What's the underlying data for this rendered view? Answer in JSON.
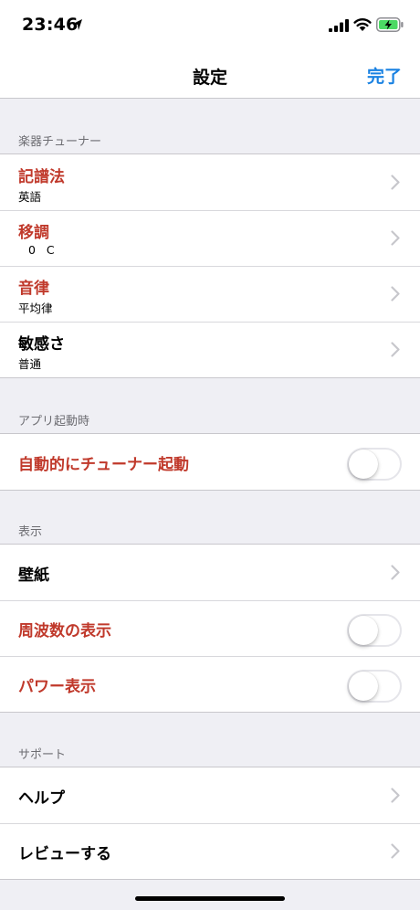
{
  "status_bar": {
    "time": "23:46"
  },
  "nav": {
    "title": "設定",
    "done_label": "完了"
  },
  "sections": {
    "tuner": {
      "header": "楽器チューナー",
      "notation": {
        "title": "記譜法",
        "value": "英語"
      },
      "transpose": {
        "title": "移調",
        "value": "0 C"
      },
      "temperament": {
        "title": "音律",
        "value": "平均律"
      },
      "sensitivity": {
        "title": "敏感さ",
        "value": "普通"
      }
    },
    "startup": {
      "header": "アプリ起動時",
      "auto_start": {
        "title": "自動的にチューナー起動",
        "on": false
      }
    },
    "display": {
      "header": "表示",
      "wallpaper": {
        "title": "壁紙"
      },
      "show_frequency": {
        "title": "周波数の表示",
        "on": false
      },
      "show_power": {
        "title": "パワー表示",
        "on": false
      }
    },
    "support": {
      "header": "サポート",
      "help": {
        "title": "ヘルプ"
      },
      "review": {
        "title": "レビューする"
      }
    }
  },
  "colors": {
    "accent_red": "#c0392b",
    "accent_blue": "#1a82e2",
    "background": "#efeff4"
  }
}
